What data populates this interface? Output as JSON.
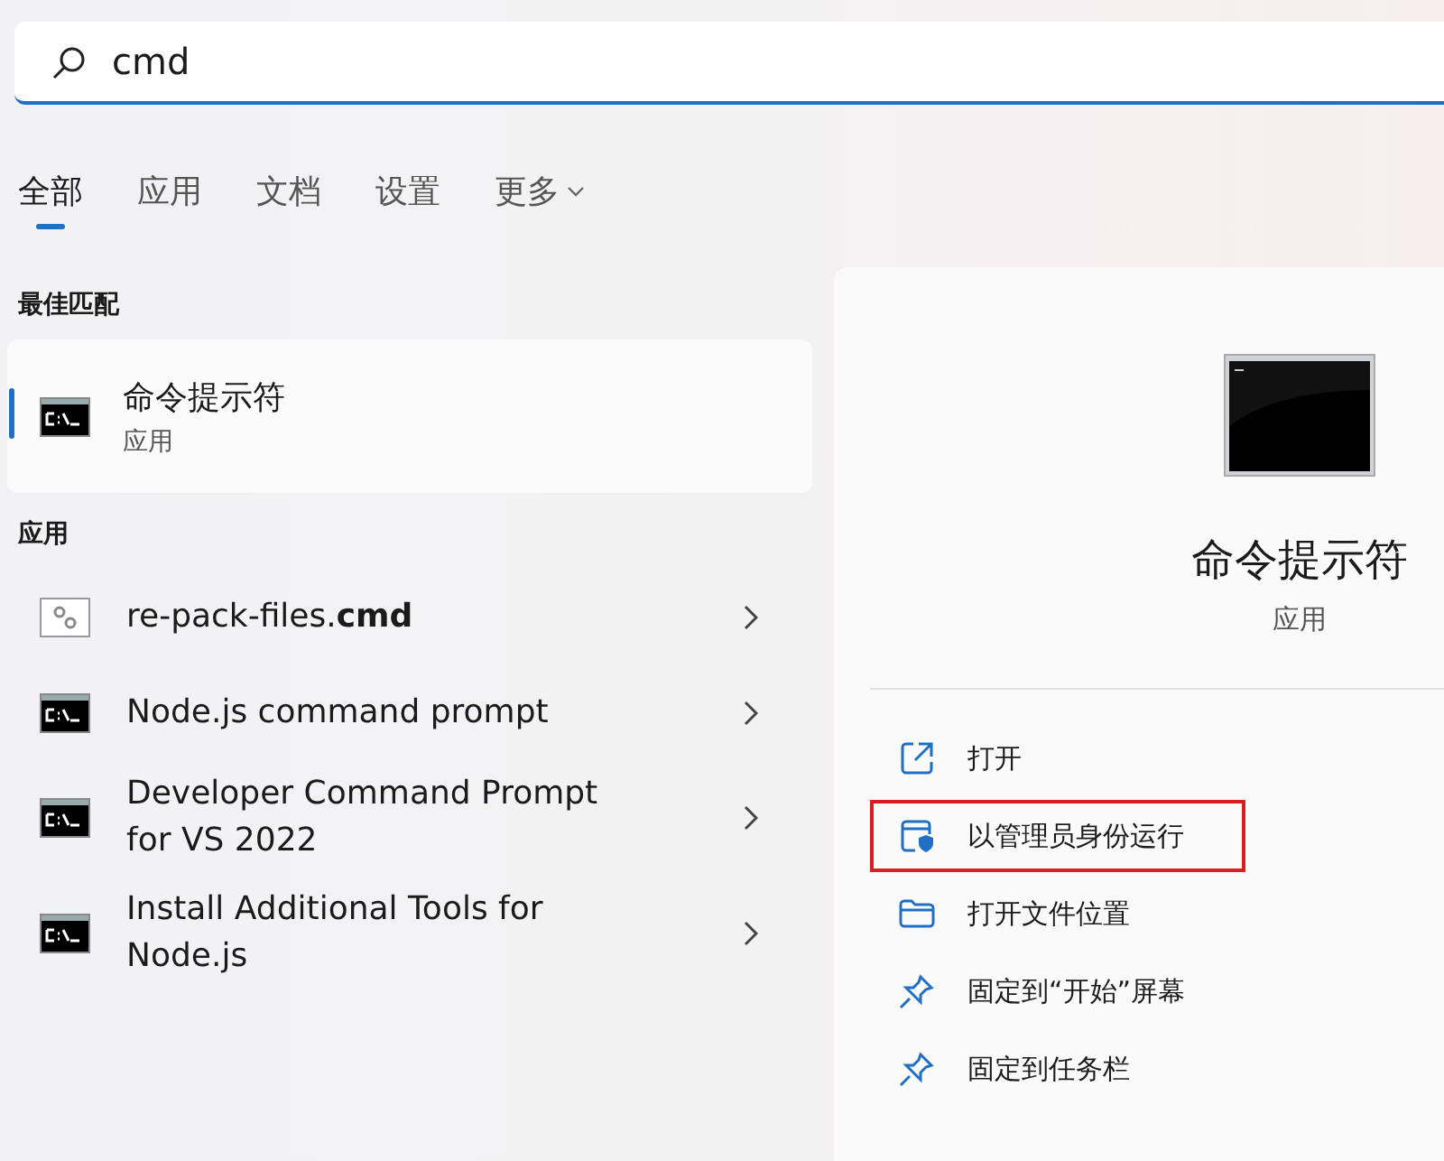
{
  "search": {
    "value": "cmd"
  },
  "tabs": [
    {
      "label": "全部",
      "selected": true
    },
    {
      "label": "应用",
      "selected": false
    },
    {
      "label": "文档",
      "selected": false
    },
    {
      "label": "设置",
      "selected": false
    },
    {
      "label": "更多",
      "selected": false,
      "dropdown": true
    }
  ],
  "best_match": {
    "heading": "最佳匹配",
    "item": {
      "title": "命令提示符",
      "subtitle": "应用",
      "selected": true
    }
  },
  "apps": {
    "heading": "应用",
    "items": [
      {
        "kind": "script",
        "title": "re-pack-files.**cmd**"
      },
      {
        "kind": "console",
        "title": "Node.js command prompt"
      },
      {
        "kind": "console",
        "title": "Developer Command Prompt\nfor VS 2022"
      },
      {
        "kind": "console",
        "title": "Install Additional Tools for\nNode.js"
      }
    ]
  },
  "detail": {
    "title": "命令提示符",
    "subtitle": "应用",
    "actions": [
      {
        "kind": "open",
        "label": "打开",
        "highlighted": false
      },
      {
        "kind": "admin",
        "label": "以管理员身份运行",
        "highlighted": true
      },
      {
        "kind": "folder",
        "label": "打开文件位置",
        "highlighted": false
      },
      {
        "kind": "pin",
        "label": "固定到“开始”屏幕",
        "highlighted": false
      },
      {
        "kind": "pin",
        "label": "固定到任务栏",
        "highlighted": false
      }
    ]
  }
}
